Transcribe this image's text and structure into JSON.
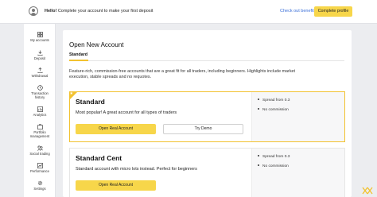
{
  "topbar": {
    "greeting": "Hello!",
    "message": "Complete your account to make your first deposit",
    "check_link": "Check out benefits",
    "complete_button": "Complete profile"
  },
  "sidebar": {
    "items": [
      {
        "label": "My accounts",
        "icon": "grid-icon"
      },
      {
        "label": "Deposit",
        "icon": "deposit-icon"
      },
      {
        "label": "Withdrawal",
        "icon": "withdrawal-icon"
      },
      {
        "label": "Transaction",
        "label2": "history",
        "icon": "history-icon"
      },
      {
        "label": "Analytics",
        "icon": "analytics-icon"
      },
      {
        "label": "Portfolio",
        "label2": "management",
        "icon": "portfolio-icon"
      },
      {
        "label": "Social trading",
        "icon": "social-trading-icon"
      },
      {
        "label": "Performance",
        "icon": "performance-icon"
      },
      {
        "label": "Settings",
        "icon": "settings-icon"
      }
    ]
  },
  "main": {
    "title": "Open New Account",
    "tab": "Standard",
    "description": "Feature-rich, commission-free accounts that are a great fit for all traders, including beginners. Highlights include market execution, stable spreads and no requotes."
  },
  "accounts": [
    {
      "name": "Standard",
      "description": "Most popular! A great account for all types of traders",
      "open_button": "Open Real Account",
      "demo_button": "Try Demo",
      "features": [
        "Spread from 0.3",
        "No commission"
      ],
      "selected": true
    },
    {
      "name": "Standard Cent",
      "description": "Standard account with micro lots instead. Perfect for beginners",
      "open_button": "Open Real Account",
      "features": [
        "Spread from 0.3",
        "No commission"
      ],
      "selected": false
    }
  ],
  "colors": {
    "accent_yellow": "#f7d64a",
    "border_yellow": "#f2c230",
    "link_blue": "#3a6fd8",
    "background": "#ecedf0"
  }
}
